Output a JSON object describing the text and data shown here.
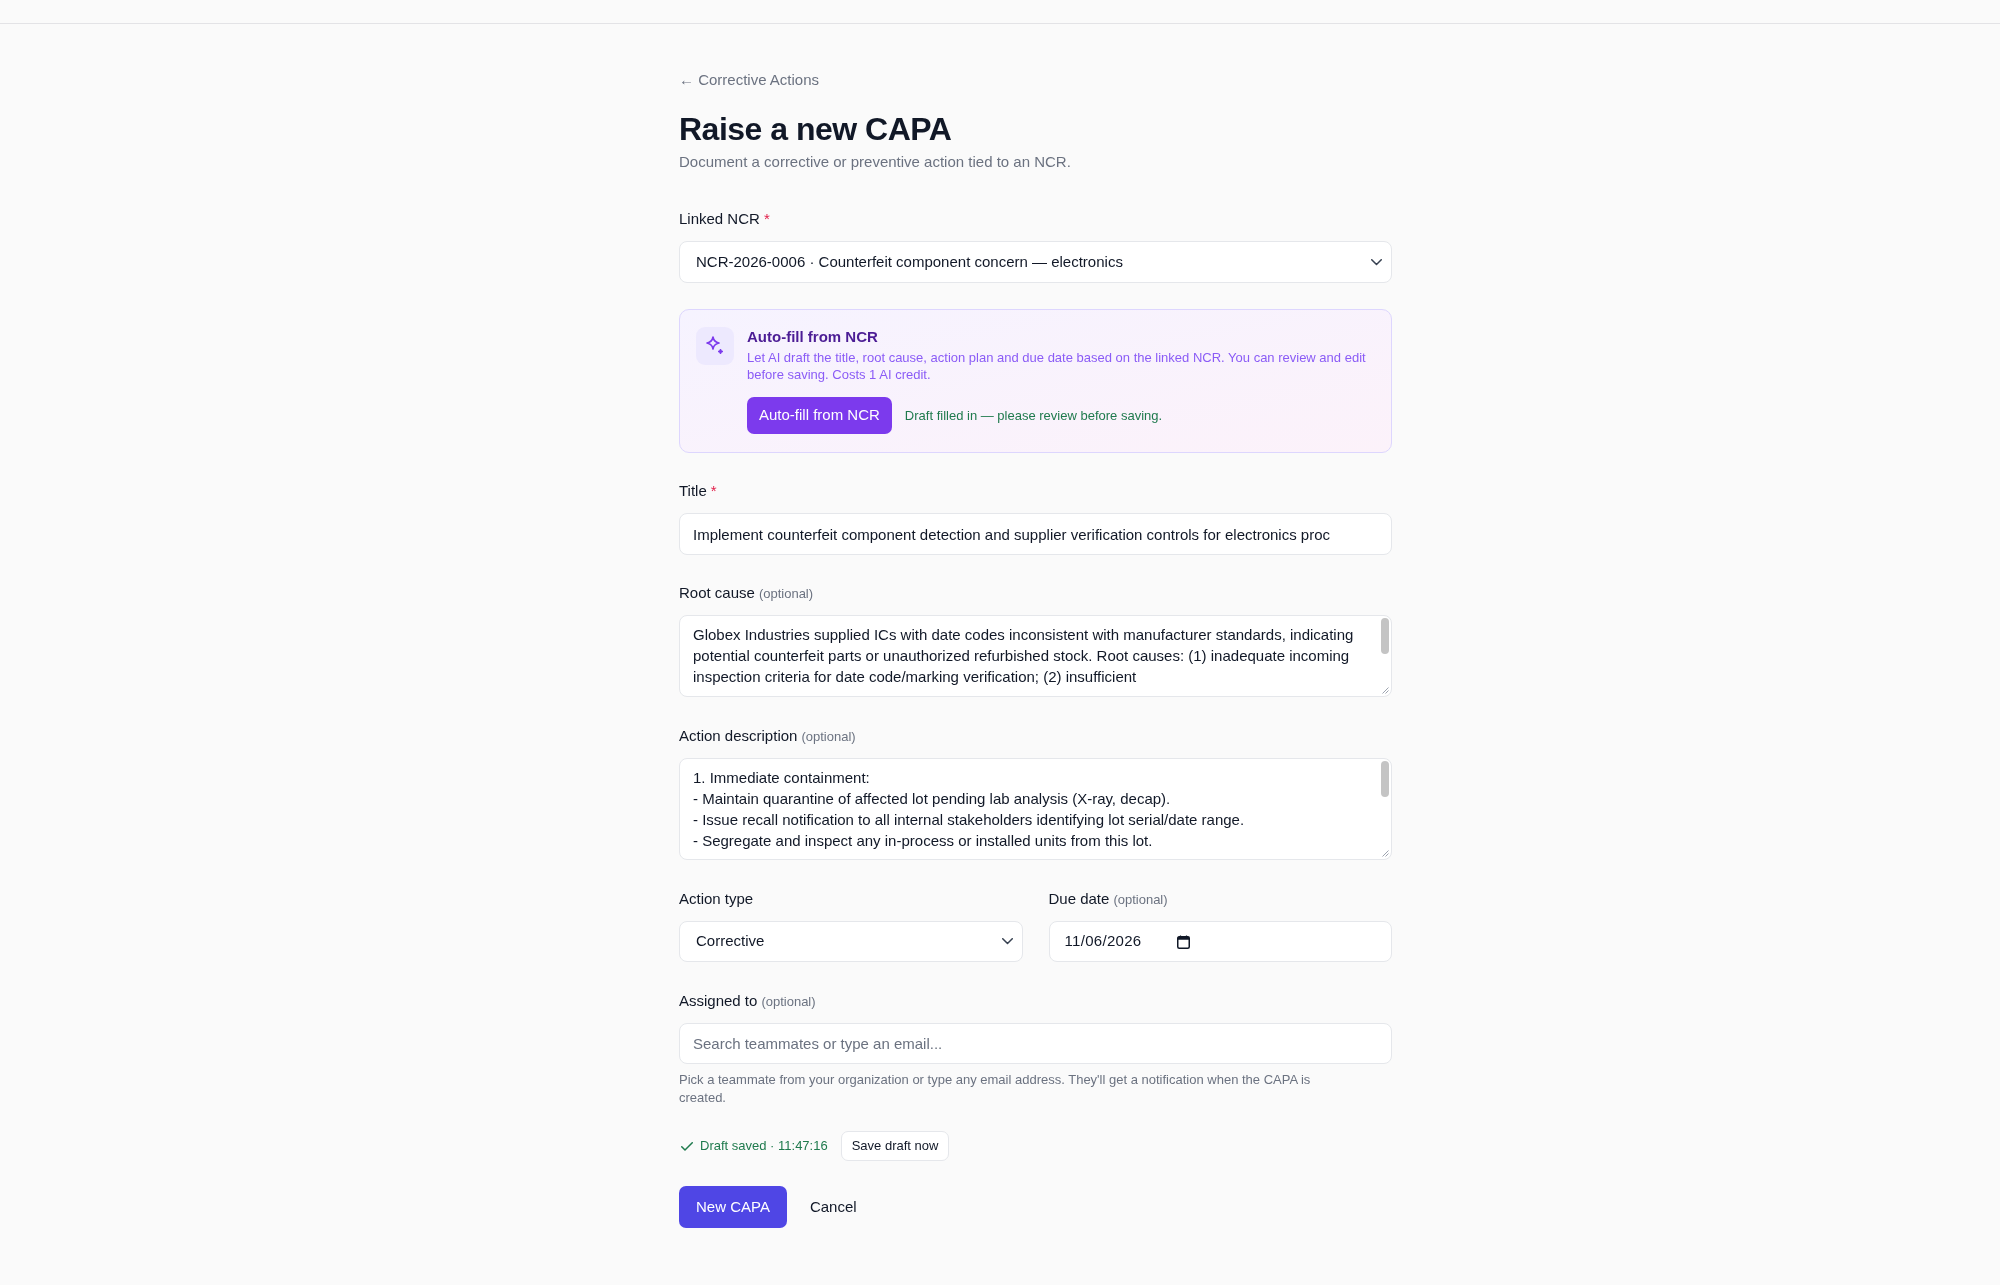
{
  "back_link": "← Corrective Actions",
  "heading": "Raise a new CAPA",
  "subtitle": "Document a corrective or preventive action tied to an NCR.",
  "linked_ncr": {
    "label": "Linked NCR",
    "required_mark": "*",
    "value": "NCR-2026-0006 · Counterfeit component concern — electronics"
  },
  "autofill": {
    "title": "Auto-fill from NCR",
    "description": "Let AI draft the title, root cause, action plan and due date based on the linked NCR. You can review and edit before saving. Costs 1 AI credit.",
    "button": "Auto-fill from NCR",
    "status": "Draft filled in — please review before saving."
  },
  "title": {
    "label": "Title",
    "required_mark": "*",
    "value": "Implement counterfeit component detection and supplier verification controls for electronics proc"
  },
  "root_cause": {
    "label": "Root cause",
    "hint": "(optional)",
    "value": "Globex Industries supplied ICs with date codes inconsistent with manufacturer standards, indicating potential counterfeit parts or unauthorized refurbished stock. Root causes: (1) inadequate incoming inspection criteria for date code/marking verification; (2) insufficient"
  },
  "action_description": {
    "label": "Action description",
    "hint": "(optional)",
    "value": "1. Immediate containment:\n- Maintain quarantine of affected lot pending lab analysis (X-ray, decap).\n- Issue recall notification to all internal stakeholders identifying lot serial/date range.\n- Segregate and inspect any in-process or installed units from this lot."
  },
  "action_type": {
    "label": "Action type",
    "value": "Corrective"
  },
  "due_date": {
    "label": "Due date",
    "hint": "(optional)",
    "value": "11/06/2026"
  },
  "assigned_to": {
    "label": "Assigned to",
    "hint": "(optional)",
    "placeholder": "Search teammates or type an email...",
    "help": "Pick a teammate from your organization or type any email address. They'll get a notification when the CAPA is created."
  },
  "draft": {
    "status": "Draft saved · 11:47:16",
    "button": "Save draft now"
  },
  "actions": {
    "submit": "New CAPA",
    "cancel": "Cancel"
  }
}
